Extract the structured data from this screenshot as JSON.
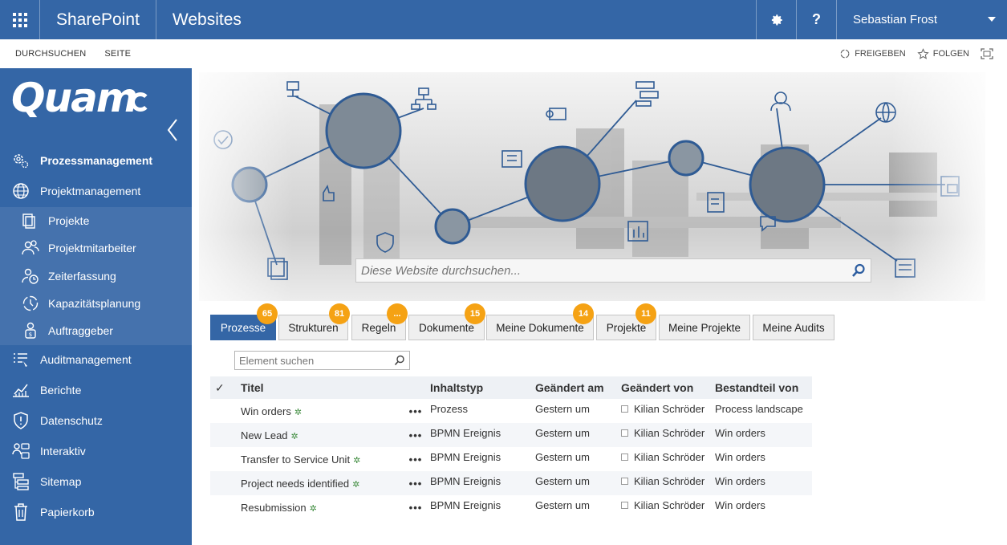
{
  "suitebar": {
    "brand": "SharePoint",
    "site_title": "Websites",
    "help": "?",
    "user": "Sebastian Frost"
  },
  "ribbon": {
    "tabs": [
      "DURCHSUCHEN",
      "SEITE"
    ],
    "share": "FREIGEBEN",
    "follow": "FOLGEN"
  },
  "leftnav": {
    "logo": "Quam",
    "items": [
      {
        "label": "Prozessmanagement",
        "icon": "gears-icon"
      },
      {
        "label": "Projektmanagement",
        "icon": "globe-icon"
      },
      {
        "label": "Projekte",
        "icon": "documents-icon"
      },
      {
        "label": "Projektmitarbeiter",
        "icon": "people-icon"
      },
      {
        "label": "Zeiterfassung",
        "icon": "person-clock-icon"
      },
      {
        "label": "Kapazitätsplanung",
        "icon": "capacity-icon"
      },
      {
        "label": "Auftraggeber",
        "icon": "client-icon"
      },
      {
        "label": "Auditmanagement",
        "icon": "audit-list-icon"
      },
      {
        "label": "Berichte",
        "icon": "chart-icon"
      },
      {
        "label": "Datenschutz",
        "icon": "shield-icon"
      },
      {
        "label": "Interaktiv",
        "icon": "interactive-icon"
      },
      {
        "label": "Sitemap",
        "icon": "sitemap-icon"
      },
      {
        "label": "Papierkorb",
        "icon": "trash-icon"
      }
    ]
  },
  "banner": {
    "search_placeholder": "Diese Website durchsuchen..."
  },
  "tabs": [
    {
      "label": "Prozesse",
      "badge": "65"
    },
    {
      "label": "Strukturen",
      "badge": "81"
    },
    {
      "label": "Regeln",
      "badge": "..."
    },
    {
      "label": "Dokumente",
      "badge": "15"
    },
    {
      "label": "Meine Dokumente",
      "badge": "14"
    },
    {
      "label": "Projekte",
      "badge": "11"
    },
    {
      "label": "Meine Projekte",
      "badge": ""
    },
    {
      "label": "Meine Audits",
      "badge": ""
    }
  ],
  "find": {
    "placeholder": "Element suchen"
  },
  "grid": {
    "columns": [
      "✓",
      "Titel",
      "Inhaltstyp",
      "Geändert am",
      "Geändert von",
      "Bestandteil von"
    ],
    "rows": [
      {
        "title": "Win orders",
        "type": "Prozess",
        "modified": "Gestern um",
        "by": "Kilian Schröder",
        "part_of": "Process landscape"
      },
      {
        "title": "New Lead",
        "type": "BPMN Ereignis",
        "modified": "Gestern um",
        "by": "Kilian Schröder",
        "part_of": "Win orders"
      },
      {
        "title": "Transfer to Service Unit",
        "type": "BPMN Ereignis",
        "modified": "Gestern um",
        "by": "Kilian Schröder",
        "part_of": "Win orders"
      },
      {
        "title": "Project needs identified",
        "type": "BPMN Ereignis",
        "modified": "Gestern um",
        "by": "Kilian Schröder",
        "part_of": "Win orders"
      },
      {
        "title": "Resubmission",
        "type": "BPMN Ereignis",
        "modified": "Gestern um",
        "by": "Kilian Schröder",
        "part_of": "Win orders"
      }
    ],
    "row_menu": "•••",
    "new_mark": "✲"
  },
  "colors": {
    "suitebar": "#3466a6",
    "nav": "#3466a6",
    "subnav": "#4572ad",
    "badge": "#f5a214"
  }
}
